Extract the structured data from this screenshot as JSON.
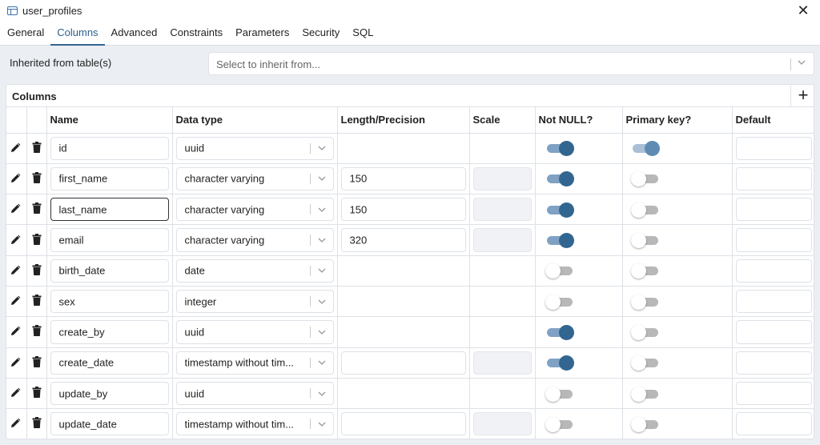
{
  "window": {
    "title": "user_profiles"
  },
  "tabs": [
    {
      "label": "General"
    },
    {
      "label": "Columns",
      "active": true
    },
    {
      "label": "Advanced"
    },
    {
      "label": "Constraints"
    },
    {
      "label": "Parameters"
    },
    {
      "label": "Security"
    },
    {
      "label": "SQL"
    }
  ],
  "inherit": {
    "label": "Inherited from table(s)",
    "placeholder": "Select to inherit from..."
  },
  "columns_panel": {
    "title": "Columns",
    "headers": [
      "Name",
      "Data type",
      "Length/Precision",
      "Scale",
      "Not NULL?",
      "Primary key?",
      "Default"
    ]
  },
  "rows": [
    {
      "name": "id",
      "type": "uuid",
      "length": "",
      "length_editable": false,
      "scale_editable": false,
      "not_null": true,
      "primary_key": true
    },
    {
      "name": "first_name",
      "type": "character varying",
      "length": "150",
      "length_editable": true,
      "scale_editable": true,
      "not_null": true,
      "primary_key": false
    },
    {
      "name": "last_name",
      "type": "character varying",
      "length": "150",
      "length_editable": true,
      "scale_editable": true,
      "not_null": true,
      "primary_key": false,
      "focused": true
    },
    {
      "name": "email",
      "type": "character varying",
      "length": "320",
      "length_editable": true,
      "scale_editable": true,
      "not_null": true,
      "primary_key": false
    },
    {
      "name": "birth_date",
      "type": "date",
      "length": "",
      "length_editable": false,
      "scale_editable": false,
      "not_null": false,
      "primary_key": false
    },
    {
      "name": "sex",
      "type": "integer",
      "length": "",
      "length_editable": false,
      "scale_editable": false,
      "not_null": false,
      "primary_key": false
    },
    {
      "name": "create_by",
      "type": "uuid",
      "length": "",
      "length_editable": false,
      "scale_editable": false,
      "not_null": true,
      "primary_key": false
    },
    {
      "name": "create_date",
      "type": "timestamp without tim...",
      "length": "",
      "length_editable": true,
      "scale_editable": true,
      "not_null": true,
      "primary_key": false
    },
    {
      "name": "update_by",
      "type": "uuid",
      "length": "",
      "length_editable": false,
      "scale_editable": false,
      "not_null": false,
      "primary_key": false
    },
    {
      "name": "update_date",
      "type": "timestamp without tim...",
      "length": "",
      "length_editable": true,
      "scale_editable": true,
      "not_null": false,
      "primary_key": false
    }
  ],
  "colors": {
    "accent": "#326690",
    "toggle_on_track": "#7fa2c4",
    "toggle_off_track": "#b8b8b8",
    "background": "#ebeef3"
  },
  "icons": {
    "title": "table-icon",
    "close": "close-icon",
    "edit": "pencil-icon",
    "delete": "trash-icon",
    "add": "plus-icon",
    "dropdown": "chevron-down-icon"
  }
}
